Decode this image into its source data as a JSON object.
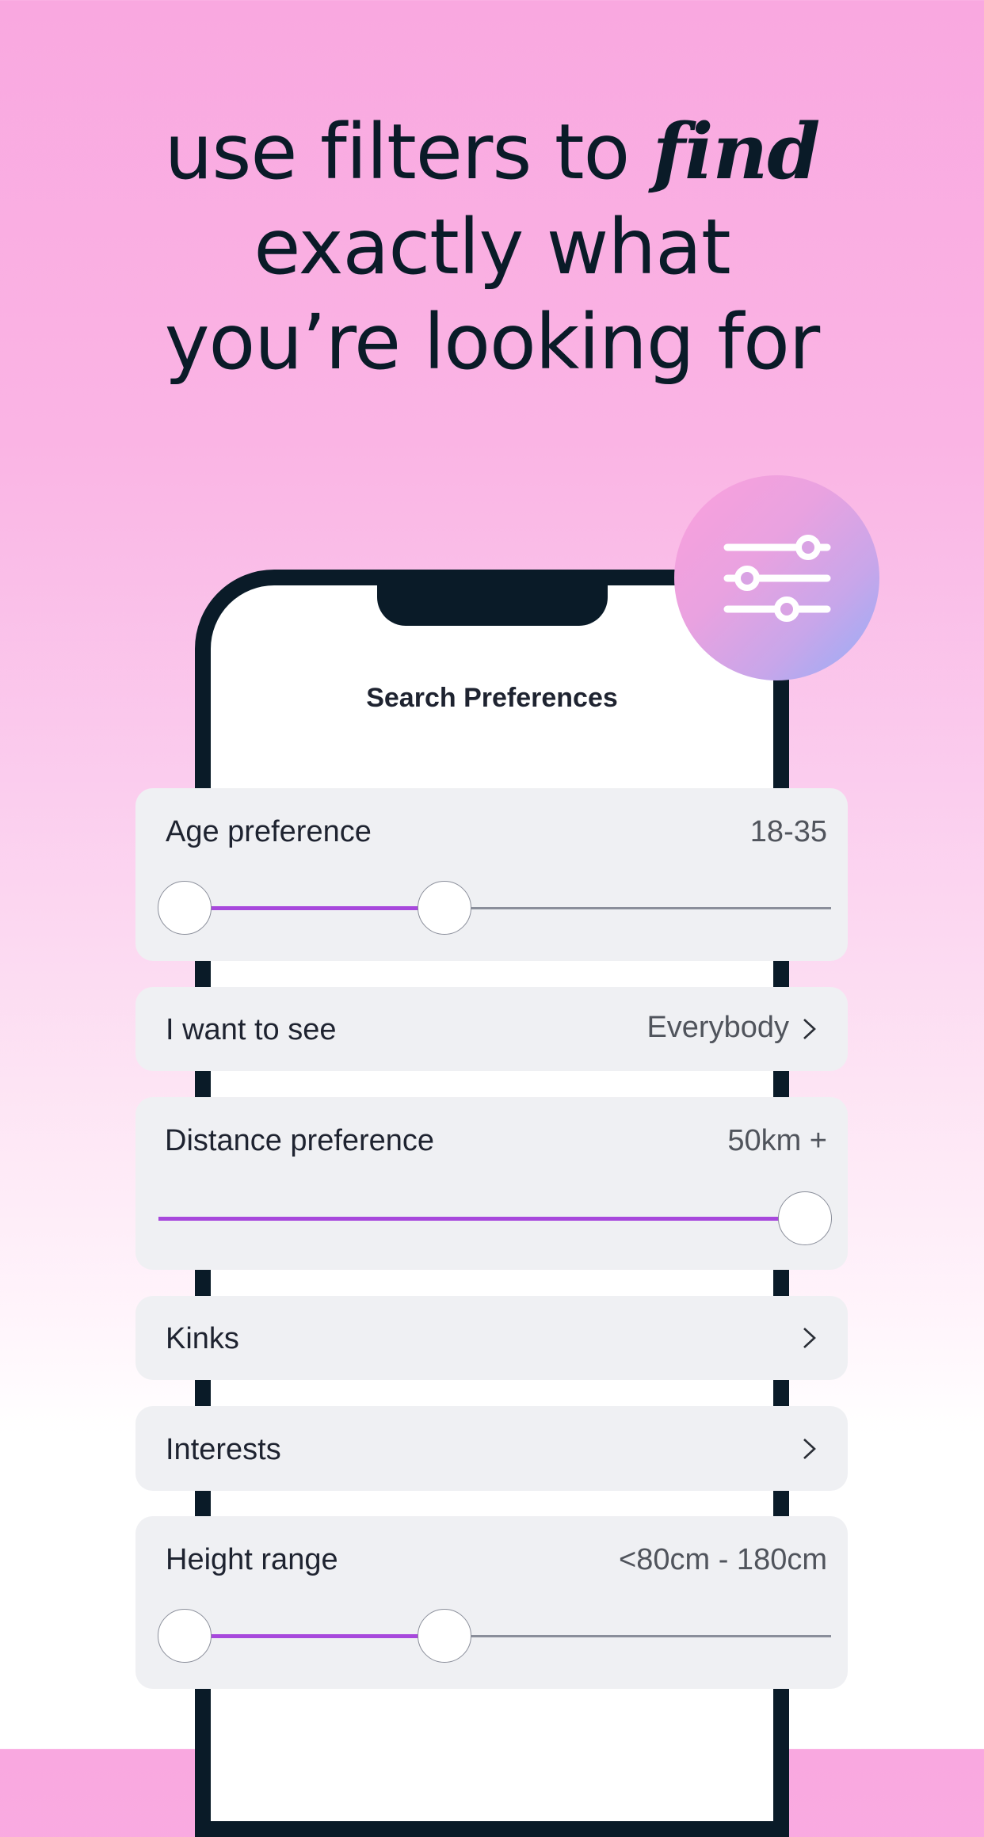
{
  "headline": {
    "line1_prefix": "use filters to ",
    "line1_emphasis": "find",
    "line2": "exactly what",
    "line3": "you’re looking for"
  },
  "fab": {
    "icon": "sliders-icon",
    "gradient_start": "#fba0dc",
    "gradient_end": "#93aef8"
  },
  "screen": {
    "title": "Search Preferences",
    "accent_color": "#a748dc",
    "preferences": [
      {
        "label": "Age preference",
        "value": "18-35",
        "type": "range-slider",
        "low_fraction": 0.0,
        "high_fraction": 0.42
      },
      {
        "label": "I want to see",
        "value": "Everybody",
        "type": "link",
        "icon": "chevron-right-icon"
      },
      {
        "label": "Distance preference",
        "value": "50km +",
        "type": "slider",
        "fraction": 1.0
      },
      {
        "label": "Kinks",
        "type": "link",
        "icon": "chevron-right-icon"
      },
      {
        "label": "Interests",
        "type": "link",
        "icon": "chevron-right-icon"
      },
      {
        "label": "Height range",
        "value": "<80cm - 180cm",
        "type": "range-slider",
        "low_fraction": 0.0,
        "high_fraction": 0.42
      }
    ]
  }
}
